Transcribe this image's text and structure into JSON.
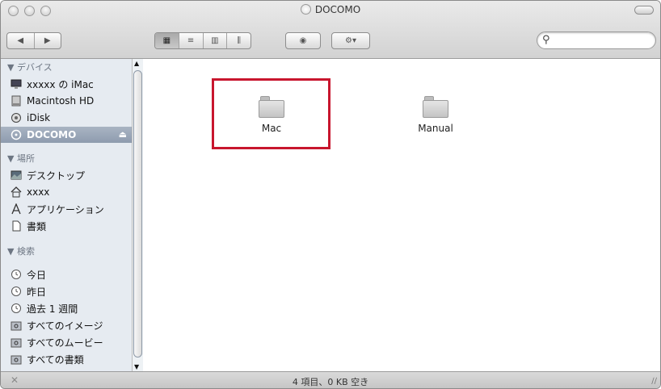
{
  "window": {
    "title": "DOCOMO"
  },
  "toolbar": {
    "back_icon": "◀",
    "forward_icon": "▶",
    "views": [
      "▦",
      "≡",
      "▥",
      "⫼"
    ],
    "quicklook_icon": "◉",
    "action_icon": "⚙▾",
    "search": {
      "icon": "🔍",
      "value": "",
      "placeholder": ""
    }
  },
  "sidebar": {
    "devices_header": "▼ デバイス",
    "devices": [
      {
        "label": "xxxxx の iMac",
        "icon": "imac-icon"
      },
      {
        "label": "Macintosh HD",
        "icon": "hard-drive-icon"
      },
      {
        "label": "iDisk",
        "icon": "idisk-icon"
      },
      {
        "label": "DOCOMO",
        "icon": "disc-icon",
        "selected": true
      }
    ],
    "places_header": "▼ 場所",
    "places": [
      {
        "label": "デスクトップ",
        "icon": "desktop-icon"
      },
      {
        "label": "xxxx",
        "icon": "home-icon"
      },
      {
        "label": "アプリケーション",
        "icon": "applications-icon"
      },
      {
        "label": "書類",
        "icon": "documents-icon"
      }
    ],
    "search_header": "▼ 検索",
    "searches": [
      {
        "label": "今日",
        "icon": "clock-icon"
      },
      {
        "label": "昨日",
        "icon": "clock-icon"
      },
      {
        "label": "過去 1 週間",
        "icon": "clock-icon"
      },
      {
        "label": "すべてのイメージ",
        "icon": "smart-folder-icon"
      },
      {
        "label": "すべてのムービー",
        "icon": "smart-folder-icon"
      },
      {
        "label": "すべての書類",
        "icon": "smart-folder-icon"
      }
    ]
  },
  "content": {
    "items": [
      {
        "name": "Mac",
        "type": "folder"
      },
      {
        "name": "Manual",
        "type": "folder"
      }
    ],
    "highlight_color": "#c8162e"
  },
  "status": {
    "text": "4 項目、0 KB 空き"
  }
}
